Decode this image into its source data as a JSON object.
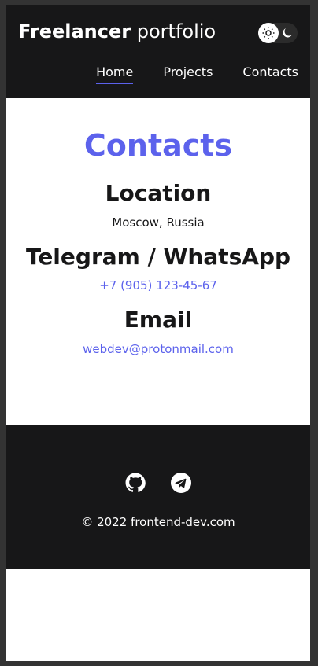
{
  "header": {
    "logo_bold": "Freelancer",
    "logo_light": "portfolio",
    "theme_light_icon": "sun-icon",
    "theme_dark_icon": "moon-icon"
  },
  "nav": {
    "items": [
      {
        "label": "Home",
        "active": true
      },
      {
        "label": "Projects",
        "active": false
      },
      {
        "label": "Contacts",
        "active": false
      }
    ]
  },
  "main": {
    "title": "Contacts",
    "sections": [
      {
        "heading": "Location",
        "value": "Moscow, Russia"
      },
      {
        "heading": "Telegram / WhatsApp",
        "value": "+7 (905) 123-45-67"
      },
      {
        "heading": "Email",
        "value": "webdev@protonmail.com"
      }
    ]
  },
  "footer": {
    "social_icons": [
      "github-icon",
      "telegram-icon"
    ],
    "copyright": "© 2022 frontend-dev.com"
  },
  "colors": {
    "accent": "#5c62ec",
    "dark": "#171718",
    "background": "#ffffff",
    "outer": "#333333"
  }
}
